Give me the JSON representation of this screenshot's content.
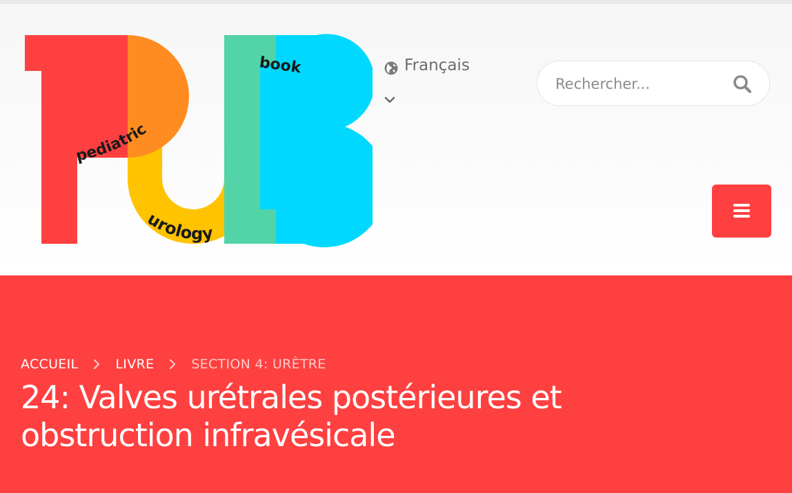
{
  "logo": {
    "letters": "PUB",
    "word_pediatric": "pediatric",
    "word_urology": "urology",
    "word_book": "book",
    "icon": "pub-logo-icon"
  },
  "language": {
    "selected": "Français",
    "icon": "globe-icon",
    "caret_icon": "chevron-down-icon"
  },
  "search": {
    "placeholder": "Rechercher...",
    "value": "",
    "icon": "search-icon"
  },
  "menu": {
    "icon": "hamburger-icon"
  },
  "breadcrumb": {
    "items": [
      {
        "label": "ACCUEIL"
      },
      {
        "label": "LIVRE"
      },
      {
        "label": "SECTION 4: URÈTRE"
      }
    ],
    "separator_icon": "chevron-right-icon"
  },
  "page": {
    "title": "24: Valves urétrales postérieures et obstruction infravésicale"
  },
  "colors": {
    "brand_red": "#ff4040",
    "logo_orange": "#ff8c20",
    "logo_yellow": "#ffc300",
    "logo_green": "#52d3a8",
    "logo_blue": "#00d8ff",
    "text_gray": "#6b6b6b"
  }
}
